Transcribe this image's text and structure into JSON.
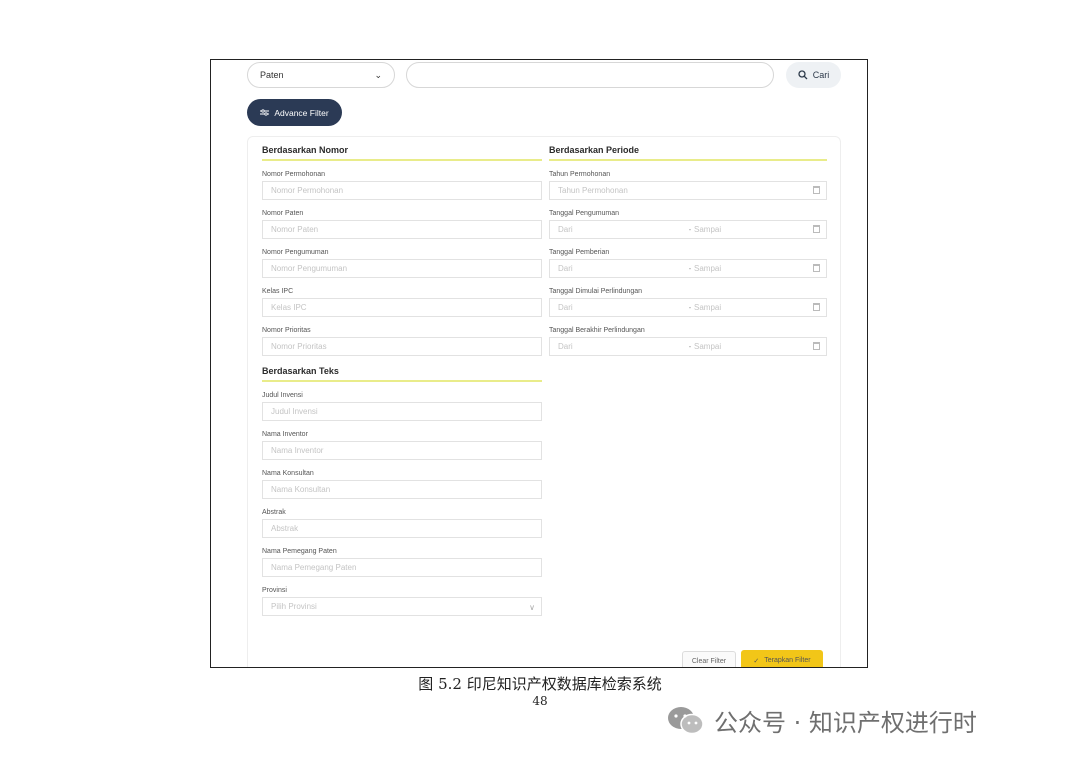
{
  "search": {
    "type_selected": "Paten",
    "search_value": "",
    "search_button": "Cari"
  },
  "advance_filter_button": "Advance Filter",
  "nomor": {
    "title": "Berdasarkan Nomor",
    "fields": [
      {
        "label": "Nomor Permohonan",
        "placeholder": "Nomor Permohonan"
      },
      {
        "label": "Nomor Paten",
        "placeholder": "Nomor Paten"
      },
      {
        "label": "Nomor Pengumuman",
        "placeholder": "Nomor Pengumuman"
      },
      {
        "label": "Kelas IPC",
        "placeholder": "Kelas IPC"
      },
      {
        "label": "Nomor Prioritas",
        "placeholder": "Nomor Prioritas"
      }
    ]
  },
  "teks": {
    "title": "Berdasarkan Teks",
    "fields": [
      {
        "label": "Judul Invensi",
        "placeholder": "Judul Invensi"
      },
      {
        "label": "Nama Inventor",
        "placeholder": "Nama Inventor"
      },
      {
        "label": "Nama Konsultan",
        "placeholder": "Nama Konsultan"
      },
      {
        "label": "Abstrak",
        "placeholder": "Abstrak"
      },
      {
        "label": "Nama Pemegang Paten",
        "placeholder": "Nama Pemegang Paten"
      },
      {
        "label": "Provinsi",
        "placeholder": "Pilih Provinsi"
      }
    ]
  },
  "periode": {
    "title": "Berdasarkan Periode",
    "tahun_label": "Tahun Permohonan",
    "tahun_placeholder": "Tahun Permohonan",
    "dari": "Dari",
    "sampai": "Sampai",
    "ranges": [
      {
        "label": "Tanggal Pengumuman"
      },
      {
        "label": "Tanggal Pemberian"
      },
      {
        "label": "Tanggal Dimulai Perlindungan"
      },
      {
        "label": "Tanggal Berakhir Perlindungan"
      }
    ]
  },
  "actions": {
    "clear": "Clear Filter",
    "apply": "Terapkan Filter"
  },
  "caption": "图 5.2  印尼知识产权数据库检索系统",
  "page_number": "48",
  "watermark": "公众号 · 知识产权进行时",
  "colors": {
    "navy": "#2b3a55",
    "accent_yellow": "#f2c618",
    "underline": "#e9ec8a"
  }
}
